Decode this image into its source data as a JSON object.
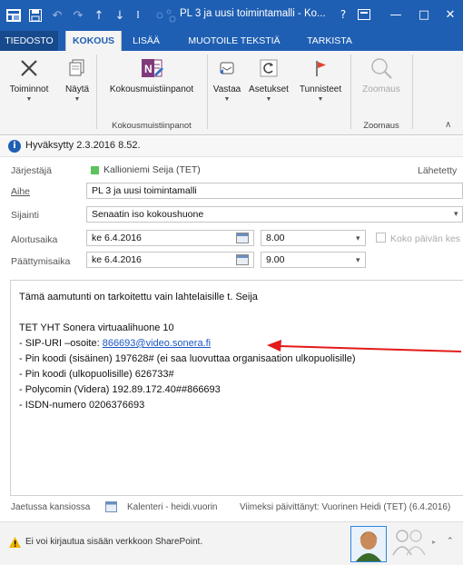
{
  "window": {
    "title": "PL 3 ja uusi toimintamalli - Ko...",
    "help": "?",
    "minimize": "—",
    "restore": "□",
    "close": "✕"
  },
  "tabs": [
    {
      "label": "TIEDOSTO"
    },
    {
      "label": "KOKOUS"
    },
    {
      "label": "LISÄÄ"
    },
    {
      "label": "MUOTOILE TEKSTIÄ"
    },
    {
      "label": "TARKISTA"
    }
  ],
  "ribbon": {
    "toiminnot": "Toiminnot",
    "nayta": "Näytä",
    "kokousmuistiinpanot_button": "Kokousmuistiinpanot",
    "kokousmuistiinpanot_group": "Kokousmuistiinpanot",
    "vastaa": "Vastaa",
    "asetukset": "Asetukset",
    "tunnisteet": "Tunnisteet",
    "zoomaus_button": "Zoomaus",
    "zoomaus_group": "Zoomaus",
    "collapse": "∧"
  },
  "info": {
    "text": "Hyväksytty 2.3.2016 8.52."
  },
  "form": {
    "organizer_label": "Järjestäjä",
    "organizer_value": "Kallioniemi Seija (TET)",
    "sent_label": "Lähetetty",
    "subject_label": "Aihe",
    "subject_value": "PL 3 ja uusi toimintamalli",
    "location_label": "Sijainti",
    "location_value": "Senaatin iso kokoushuone",
    "start_label": "Aloıtusaika",
    "start_date": "ke 6.4.2016",
    "start_time": "8.00",
    "all_day_label": "Koko päivän kes",
    "end_label": "Päättymisaika",
    "end_date": "ke 6.4.2016",
    "end_time": "9.00"
  },
  "body": {
    "line1": "Tämä aamutunti on tarkoitettu vain lahtelaisille t. Seija",
    "line2": "TET YHT Sonera virtuaalihuone 10",
    "line3_prefix": "- SIP-URI –osoite: ",
    "line3_link": "866693@video.sonera.fi",
    "line4": "- Pin koodi (sisäinen) 197628# (ei saa luovuttaa organisaation ulkopuolisille)",
    "line5": "- Pin koodi (ulkopuolisille) 626733#",
    "line6": "- Polycomin (Videra) 192.89.172.40##866693",
    "line7": "- ISDN-numero 0206376693"
  },
  "footer": {
    "shared": "Jaetussa kansiossa",
    "calendar": "Kalenteri - heidi.vuorin",
    "modified": "Viimeksi päivittänyt: Vuorinen Heidi (TET) (6.4.2016)",
    "sharepoint": "Ei voi kirjautua sisään verkkoon SharePoint."
  },
  "colors": {
    "accent": "#1f5fb3",
    "annotation_arrow": "#e31b1b",
    "organizer_badge": "#5cc25c",
    "warning": "#f0b400"
  }
}
